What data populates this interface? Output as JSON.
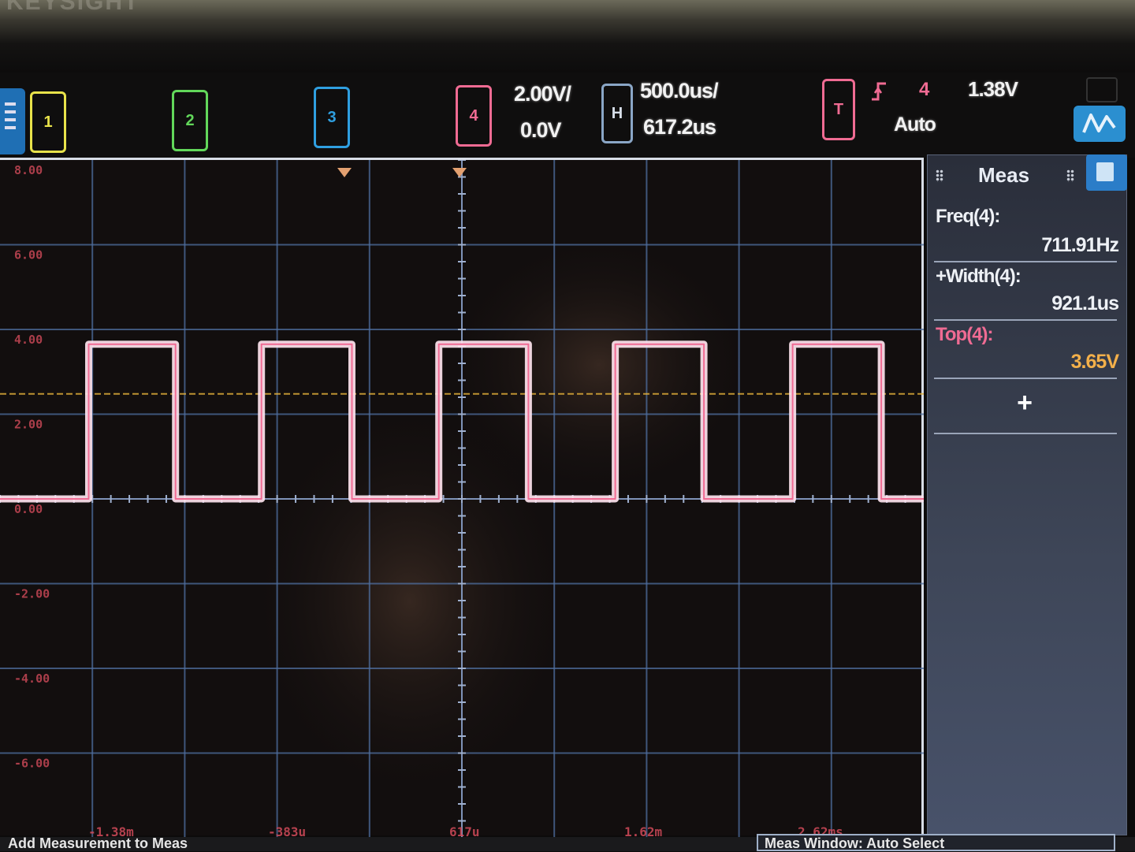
{
  "brand": "KEYSIGHT",
  "channels": [
    {
      "label": "1",
      "color": "#e8e24a"
    },
    {
      "label": "2",
      "color": "#62d75a"
    },
    {
      "label": "3",
      "color": "#2f9fe0"
    },
    {
      "label": "4",
      "color": "#f06b93"
    }
  ],
  "vertical": {
    "scale": "2.00V/",
    "offset": "0.0V"
  },
  "horizontal": {
    "label": "H",
    "scale": "500.0us/",
    "position": "617.2us"
  },
  "trigger": {
    "label": "T",
    "source": "4",
    "level": "1.38V",
    "mode": "Auto",
    "edge": "rising-edge-icon"
  },
  "grid": {
    "h_divisions": 10,
    "v_divisions": 8
  },
  "y_labels": [
    "8.00",
    "6.00",
    "4.00",
    "2.00",
    "0.00",
    "-2.00",
    "-4.00",
    "-6.00"
  ],
  "x_labels": [
    "-1.38m",
    "-383u",
    "617u",
    "1.62m",
    "2.62ms"
  ],
  "measurements": {
    "title": "Meas",
    "items": [
      {
        "name": "Freq(4):",
        "value": "711.91Hz",
        "value_color": "#eef1f6",
        "name_color": "#eef1f6"
      },
      {
        "name": "+Width(4):",
        "value": "921.1us",
        "value_color": "#eef1f6",
        "name_color": "#eef1f6"
      },
      {
        "name": "Top(4):",
        "value": "3.65V",
        "value_color": "#f3b04a",
        "name_color": "#f06b93"
      }
    ],
    "add_label": "+"
  },
  "status": {
    "left": "Add Measurement to Meas",
    "right": "Meas Window: Auto Select"
  },
  "chart_data": {
    "type": "line",
    "title": "",
    "xlabel": "",
    "ylabel": "",
    "ylim": [
      -8,
      8
    ],
    "xlim": [
      -4.38,
      5.62
    ],
    "series": [
      {
        "channel": "4",
        "color": "#f06b93",
        "x": [
          -4.38,
          -3.42,
          -3.42,
          -2.48,
          -2.48,
          -1.55,
          -1.55,
          -0.57,
          -0.57,
          0.37,
          0.37,
          1.34,
          1.34,
          2.28,
          2.28,
          3.24,
          3.24,
          4.2,
          4.2,
          5.16,
          5.16,
          5.62
        ],
        "y": [
          0.0,
          0.0,
          3.65,
          3.65,
          0.0,
          0.0,
          3.65,
          3.65,
          0.0,
          0.0,
          3.65,
          3.65,
          0.0,
          0.0,
          3.65,
          3.65,
          0.0,
          0.0,
          3.65,
          3.65,
          0.0,
          0.0
        ]
      }
    ],
    "trigger_level": 1.38
  }
}
